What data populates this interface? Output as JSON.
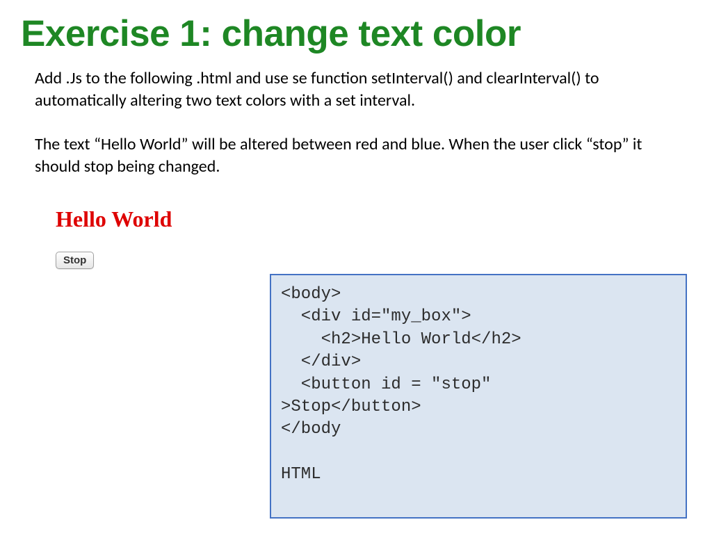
{
  "title": "Exercise 1: change text color",
  "description": {
    "p1": "Add .Js to the following .html  and use se function setInterval() and clearInterval() to automatically altering two text colors with a set interval.",
    "p2": "The text “Hello World” will be altered between red and blue. When the user click “stop” it should stop being changed."
  },
  "demo": {
    "heading": "Hello World",
    "button_label": "Stop"
  },
  "code": "<body>\n  <div id=\"my_box\">\n    <h2>Hello World</h2>\n  </div>\n  <button id = \"stop\"\n>Stop</button>\n</body\n\nHTML"
}
